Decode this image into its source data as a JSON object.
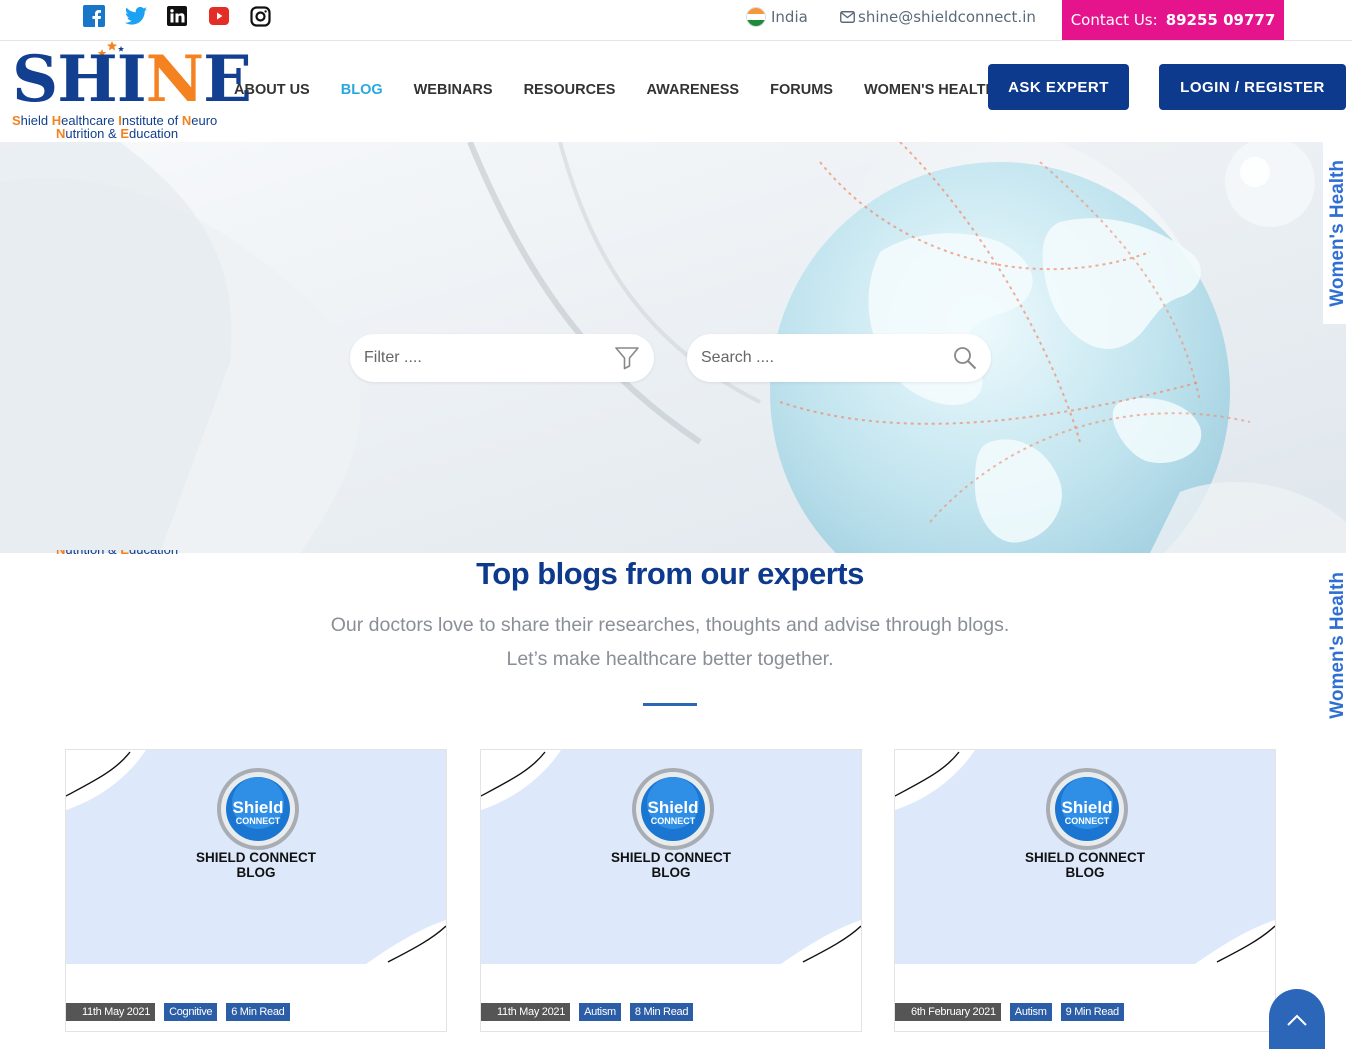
{
  "topbar": {
    "social": [
      "facebook-icon",
      "twitter-icon",
      "linkedin-icon",
      "youtube-icon",
      "instagram-icon"
    ],
    "country": "India",
    "email": "shine@shieldconnect.in",
    "contact_label": "Contact Us:",
    "contact_number": "89255 09777"
  },
  "logo": {
    "word_a": "SH",
    "word_b": "I",
    "word_c": "N",
    "word_d": "E",
    "line1": [
      "S",
      "hield ",
      "H",
      "ealthcare ",
      "I",
      "nstitute of ",
      "N",
      "euro"
    ],
    "line2": [
      "N",
      "utrition & ",
      "E",
      "ducation"
    ]
  },
  "nav": {
    "items": [
      "ABOUT US",
      "BLOG",
      "WEBINARS",
      "RESOURCES",
      "AWARENESS",
      "FORUMS",
      "WOMEN'S HEALTH"
    ],
    "active": "BLOG",
    "ask_expert": "ASK EXPERT",
    "login": "LOGIN / REGISTER"
  },
  "hero": {
    "filter_placeholder": "Filter ....",
    "search_placeholder": "Search ...."
  },
  "side_tab": "Women's Health",
  "section": {
    "title": "Top blogs from our experts",
    "line1": "Our doctors love to share their researches, thoughts and advise through blogs.",
    "line2": "Let’s make healthcare better together."
  },
  "cards": [
    {
      "badge_a": "Shield",
      "badge_b": "CONNECT",
      "title_a": "SHIELD CONNECT",
      "title_b": "BLOG",
      "date": "11th May 2021",
      "category": "Cognitive",
      "read": "6 Min Read"
    },
    {
      "badge_a": "Shield",
      "badge_b": "CONNECT",
      "title_a": "SHIELD CONNECT",
      "title_b": "BLOG",
      "date": "11th May 2021",
      "category": "Autism",
      "read": "8 Min Read"
    },
    {
      "badge_a": "Shield",
      "badge_b": "CONNECT",
      "title_a": "SHIELD CONNECT",
      "title_b": "BLOG",
      "date": "6th February 2021",
      "category": "Autism",
      "read": "9 Min Read"
    }
  ],
  "colors": {
    "brand_navy": "#0d3a8c",
    "brand_orange": "#f58220",
    "contact_pink": "#e5148c",
    "active_link": "#29a8e0",
    "card_bg": "#dde9fb",
    "tag_blue": "#2c5ea8"
  }
}
